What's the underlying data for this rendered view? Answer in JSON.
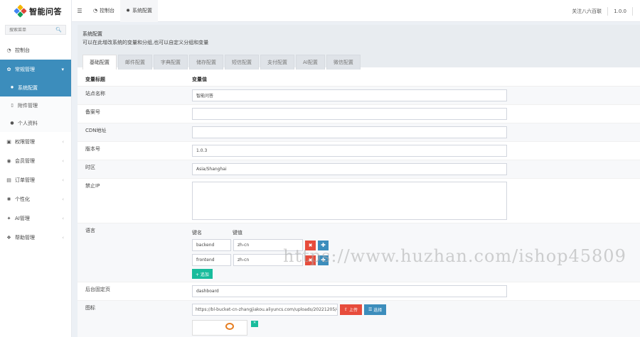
{
  "app": {
    "name": "智能问答"
  },
  "sidebar": {
    "search_placeholder": "搜索菜单",
    "items": [
      {
        "label": "控制台",
        "icon": "dashboard-icon",
        "active": false
      },
      {
        "label": "常规管理",
        "icon": "cogs-icon",
        "active": true
      },
      {
        "label": "权限管理",
        "icon": "group-icon",
        "active": false
      },
      {
        "label": "会员管理",
        "icon": "user-circle-icon",
        "active": false
      },
      {
        "label": "订单管理",
        "icon": "order-icon",
        "active": false
      },
      {
        "label": "个性化",
        "icon": "palette-icon",
        "active": false
      },
      {
        "label": "AI管理",
        "icon": "ai-icon",
        "active": false
      },
      {
        "label": "帮助管理",
        "icon": "help-icon",
        "active": false
      }
    ],
    "subitems": [
      {
        "label": "系统配置",
        "icon": "gear-icon",
        "active": true
      },
      {
        "label": "附件管理",
        "icon": "file-icon",
        "active": false
      },
      {
        "label": "个人资料",
        "icon": "user-icon",
        "active": false
      }
    ]
  },
  "header": {
    "tabs": [
      {
        "label": "控制台",
        "icon": "dashboard-icon"
      },
      {
        "label": "系统配置",
        "icon": "gear-icon"
      }
    ],
    "right_text": "关注八六百联",
    "version": "1.0.0"
  },
  "panel": {
    "title": "系统配置",
    "description": "可以在此增改系统的变量和分组,也可以自定义分组和变量",
    "tabs": [
      "基础配置",
      "邮件配置",
      "字典配置",
      "储存配置",
      "短信配置",
      "支付配置",
      "AI配置",
      "微信配置"
    ],
    "col_title": "变量标题",
    "col_value": "变量值"
  },
  "fields": {
    "site_name": {
      "label": "站点名称",
      "value": "智能问答"
    },
    "beian": {
      "label": "备案号",
      "value": ""
    },
    "cdn": {
      "label": "CDN地址",
      "value": ""
    },
    "version": {
      "label": "版本号",
      "value": "1.0.3"
    },
    "timezone": {
      "label": "时区",
      "value": "Asia/Shanghai"
    },
    "forbidden_ip": {
      "label": "禁止IP",
      "value": ""
    },
    "language": {
      "label": "语言",
      "key_header": "键名",
      "value_header": "键值",
      "rows": [
        {
          "key": "backend",
          "value": "zh-cn"
        },
        {
          "key": "frontend",
          "value": "zh-cn"
        }
      ],
      "add_label": "+ 追加"
    },
    "fixed_page": {
      "label": "后台固定页",
      "value": "dashboard"
    },
    "logo": {
      "label": "图标",
      "value": "https://bl-bucket-cn-zhangjiakou.aliyuncs.com/uploads/20221205/4b",
      "upload_label": "上传",
      "choose_label": "选择"
    }
  },
  "watermark": "https://www.huzhan.com/ishop45809"
}
